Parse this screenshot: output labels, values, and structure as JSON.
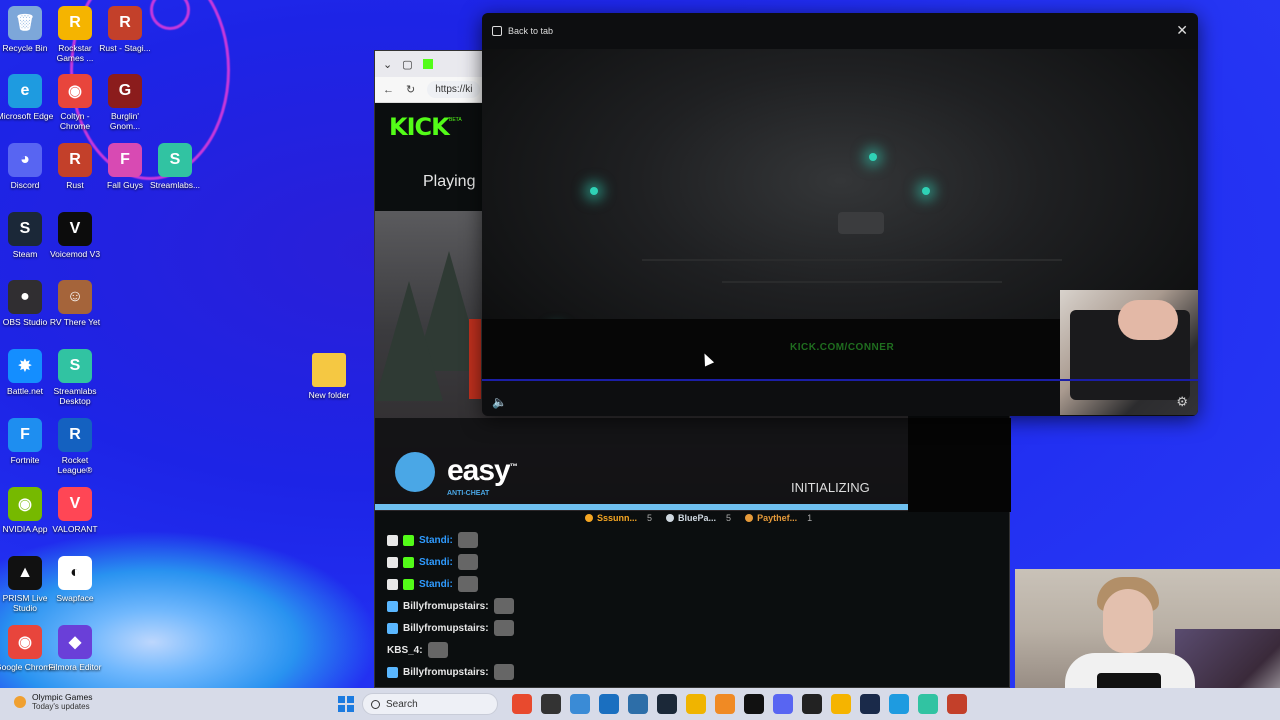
{
  "desktop": {
    "icons": [
      {
        "label": "Recycle Bin",
        "glyph": "🗑",
        "color": "#7da7d9"
      },
      {
        "label": "Rockstar Games ...",
        "glyph": "R",
        "color": "#f5b400"
      },
      {
        "label": "Rust - Stagi...",
        "glyph": "R",
        "color": "#c3402a"
      },
      {
        "label": "Microsoft Edge",
        "glyph": "e",
        "color": "#1e9be0"
      },
      {
        "label": "Coltyn - Chrome",
        "glyph": "◉",
        "color": "#e8453c"
      },
      {
        "label": "Burglin' Gnom...",
        "glyph": "G",
        "color": "#8b1c1c"
      },
      {
        "label": "Discord",
        "glyph": "◕",
        "color": "#5865f2"
      },
      {
        "label": "Rust",
        "glyph": "R",
        "color": "#c3402a"
      },
      {
        "label": "Fall Guys",
        "glyph": "F",
        "color": "#d84ab3"
      },
      {
        "label": "Streamlabs...",
        "glyph": "S",
        "color": "#31c3a2"
      },
      {
        "label": "Steam",
        "glyph": "S",
        "color": "#1b2838"
      },
      {
        "label": "Voicemod V3",
        "glyph": "V",
        "color": "#0c0c0c"
      },
      {
        "label": "OBS Studio",
        "glyph": "●",
        "color": "#302e31"
      },
      {
        "label": "RV There Yet",
        "glyph": "☺",
        "color": "#a5643a"
      },
      {
        "label": "Battle.net",
        "glyph": "✸",
        "color": "#148eff"
      },
      {
        "label": "Streamlabs Desktop",
        "glyph": "S",
        "color": "#31c3a2"
      },
      {
        "label": "Fortnite",
        "glyph": "F",
        "color": "#1e8ef0"
      },
      {
        "label": "Rocket League®",
        "glyph": "R",
        "color": "#1461c0"
      },
      {
        "label": "NVIDIA App",
        "glyph": "◉",
        "color": "#76b900"
      },
      {
        "label": "VALORANT",
        "glyph": "V",
        "color": "#ff4655"
      },
      {
        "label": "PRISM Live Studio",
        "glyph": "▲",
        "color": "#111111"
      },
      {
        "label": "Swapface",
        "glyph": "◐",
        "color": "#ffffff"
      },
      {
        "label": "Google Chrome",
        "glyph": "◉",
        "color": "#e8453c"
      },
      {
        "label": "Filmora Editor",
        "glyph": "◆",
        "color": "#6a3fd8"
      }
    ],
    "new_folder_label": "New folder"
  },
  "browser": {
    "url": "https://ki",
    "kick_logo": "KICK",
    "kick_beta": "BETA",
    "playing_text": "Playing",
    "easy_logo": "easy",
    "easy_tm": "™",
    "easy_sub": "ANTI-CHEAT",
    "easy_status": "INITIALIZING",
    "gifters": [
      {
        "name": "Sssunn...",
        "count": "5",
        "color": "#f5a623"
      },
      {
        "name": "BluePa...",
        "count": "5",
        "color": "#cfd8e0"
      },
      {
        "name": "Paythef...",
        "count": "1",
        "color": "#e59a3a"
      }
    ],
    "chat": [
      {
        "user": "Standi:",
        "user_color": "#2f9bff",
        "badges": [
          "mod",
          "sub"
        ]
      },
      {
        "user": "Standi:",
        "user_color": "#2f9bff",
        "badges": [
          "mod",
          "sub"
        ]
      },
      {
        "user": "Standi:",
        "user_color": "#2f9bff",
        "badges": [
          "mod",
          "sub"
        ]
      },
      {
        "user": "Billyfromupstairs:",
        "user_color": "#e8e8e8",
        "badges": [
          "verified"
        ]
      },
      {
        "user": "Billyfromupstairs:",
        "user_color": "#e8e8e8",
        "badges": [
          "verified"
        ]
      },
      {
        "user": "KBS_4:",
        "user_color": "#e8e8e8",
        "badges": []
      },
      {
        "user": "Billyfromupstairs:",
        "user_color": "#e8e8e8",
        "badges": [
          "verified"
        ]
      }
    ]
  },
  "pip": {
    "back_to_tab": "Back to tab",
    "close_icon": "✕",
    "watermark": "KICK.COM/CONNER"
  },
  "taskbar": {
    "weather_title": "Olympic Games",
    "weather_sub": "Today's updates",
    "search_label": "Search",
    "apps": [
      "#e84a2e",
      "#333333",
      "#3a8bd6",
      "#1a6fc0",
      "#2d6ea8",
      "#1b2838",
      "#f0b400",
      "#f08a24",
      "#111111",
      "#5865f2",
      "#222222",
      "#f5b400",
      "#1a2a4a",
      "#1e9be0",
      "#31c3a2",
      "#c3402a"
    ]
  },
  "colors": {
    "kick_green": "#53fc18",
    "wallpaper_blue": "#2230f2"
  }
}
